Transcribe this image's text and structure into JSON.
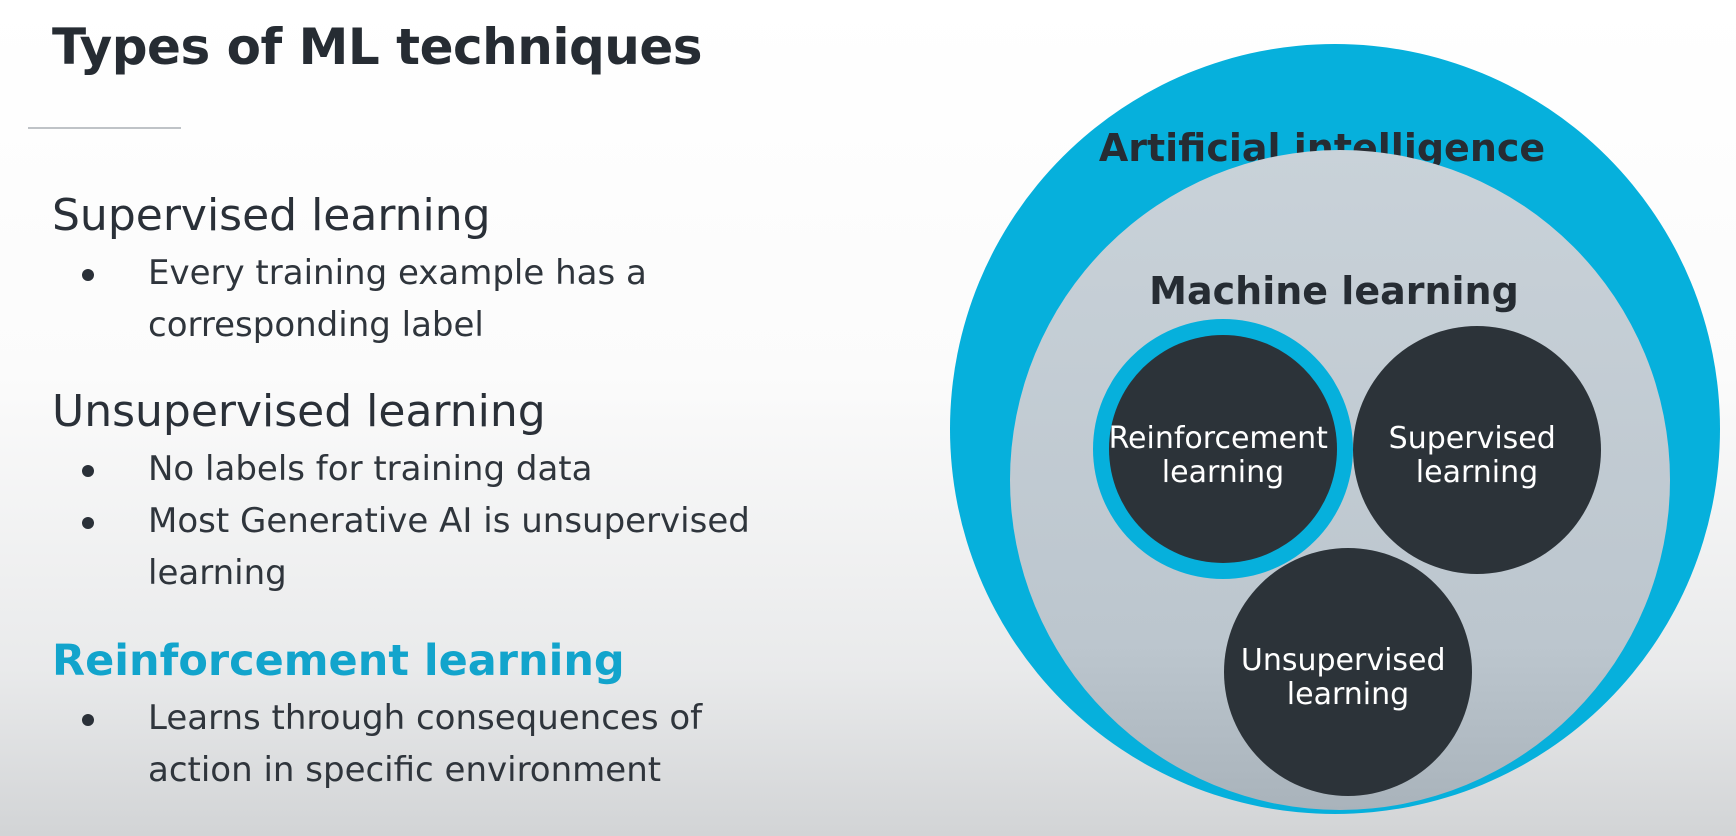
{
  "title": "Types of ML techniques",
  "sections": {
    "supervised": {
      "heading": "Supervised learning",
      "bullets": [
        "Every training example has a corresponding label"
      ]
    },
    "unsupervised": {
      "heading": "Unsupervised learning",
      "bullets": [
        "No labels for training data",
        "Most Generative AI is unsupervised learning"
      ]
    },
    "reinforcement": {
      "heading": "Reinforcement learning",
      "bullets": [
        "Learns through consequences of action in specific environment"
      ]
    }
  },
  "diagram": {
    "outer_label": "Artificial intelligence",
    "inner_label": "Machine learning",
    "circles": {
      "reinforcement": [
        "Reinforcement",
        "learning"
      ],
      "supervised": [
        "Supervised",
        "learning"
      ],
      "unsupervised": [
        "Unsupervised",
        "learning"
      ]
    },
    "highlighted": "reinforcement"
  },
  "colors": {
    "accent": "#12a4cc",
    "outer_circle": "#06b0dc",
    "inner_circle": "#c2ccd4",
    "node_circle": "#2c3339",
    "text_dark": "#262c33"
  }
}
